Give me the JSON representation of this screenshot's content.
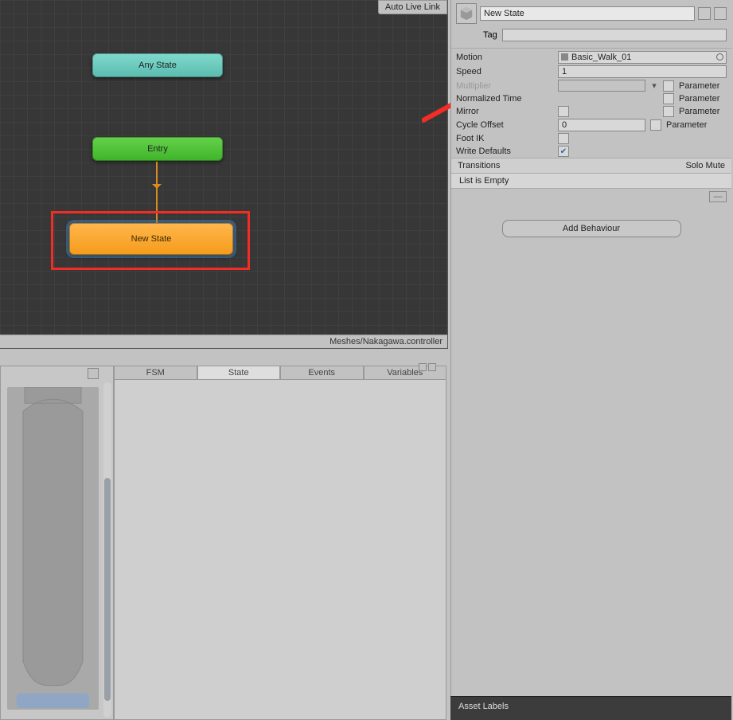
{
  "animator": {
    "auto_live_link": "Auto Live Link",
    "asset_path": "Meshes/Nakagawa.controller",
    "nodes": {
      "any_state": "Any State",
      "entry": "Entry",
      "new_state": "New State"
    }
  },
  "playmaker_tabs": {
    "fsm": "FSM",
    "state": "State",
    "events": "Events",
    "variables": "Variables"
  },
  "inspector": {
    "name": "New State",
    "tag_label": "Tag",
    "tag_value": "",
    "props": {
      "motion": {
        "label": "Motion",
        "value": "Basic_Walk_01"
      },
      "speed": {
        "label": "Speed",
        "value": "1"
      },
      "multiplier": {
        "label": "Multiplier",
        "value": "",
        "param": "Parameter"
      },
      "normalized_time": {
        "label": "Normalized Time",
        "param": "Parameter"
      },
      "mirror": {
        "label": "Mirror",
        "param": "Parameter"
      },
      "cycle_offset": {
        "label": "Cycle Offset",
        "value": "0",
        "param": "Parameter"
      },
      "foot_ik": {
        "label": "Foot IK"
      },
      "write_defaults": {
        "label": "Write Defaults"
      }
    },
    "transitions": {
      "header": "Transitions",
      "solo_mute": "Solo  Mute",
      "empty": "List is Empty"
    },
    "add_behaviour": "Add Behaviour",
    "asset_labels": "Asset Labels"
  }
}
